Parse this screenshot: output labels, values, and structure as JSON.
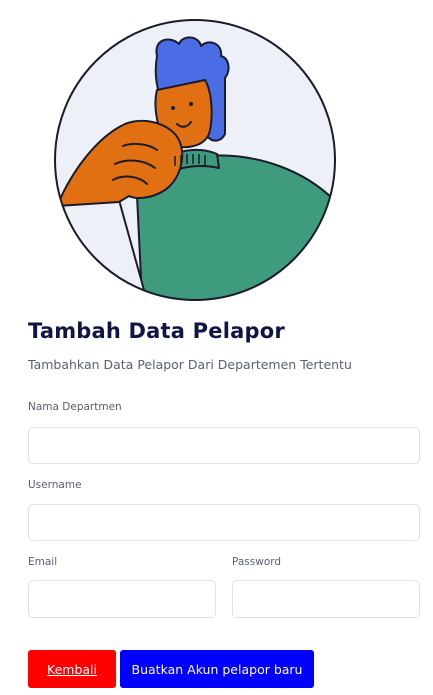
{
  "header": {
    "title": "Tambah Data Pelapor",
    "subtitle": "Tambahkan Data Pelapor Dari Departemen Tertentu"
  },
  "form": {
    "departemen": {
      "label": "Nama Departmen",
      "value": "",
      "placeholder": ""
    },
    "username": {
      "label": "Username",
      "value": "",
      "placeholder": ""
    },
    "email": {
      "label": "Email",
      "value": "",
      "placeholder": ""
    },
    "password": {
      "label": "Password",
      "value": "",
      "placeholder": ""
    }
  },
  "actions": {
    "back_label": "Kembali",
    "create_label": "Buatkan Akun pelapor baru"
  },
  "colors": {
    "title": "#0f1545",
    "back_button": "#ff0000",
    "create_button": "#0000ff",
    "illustration_sweater": "#3f9b7e",
    "illustration_hair": "#4a6de5",
    "illustration_skin": "#e07012"
  },
  "illustration": {
    "icon": "person-thinking-illustration"
  }
}
